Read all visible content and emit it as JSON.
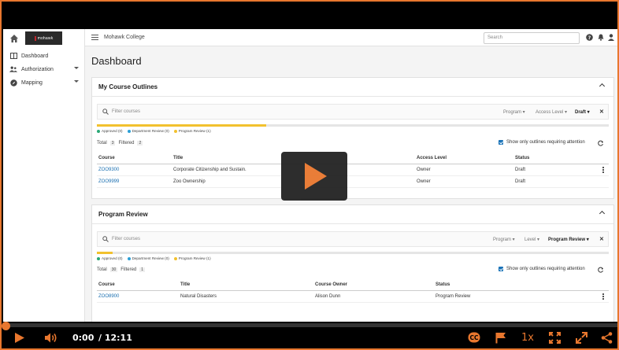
{
  "sidebar": {
    "logo_text": "mohawk",
    "items": [
      {
        "label": "Dashboard",
        "icon": "dashboard-icon"
      },
      {
        "label": "Authorization",
        "icon": "users-icon"
      },
      {
        "label": "Mapping",
        "icon": "compass-icon"
      }
    ]
  },
  "topbar": {
    "college": "Mohawk College",
    "search_placeholder": "Search"
  },
  "page": {
    "title": "Dashboard"
  },
  "outlines": {
    "title": "My Course Outlines",
    "filter_placeholder": "Filter courses",
    "filters": [
      "Program",
      "Access Level",
      "Draft"
    ],
    "progress": 0.33,
    "legend": [
      {
        "label": "Approved (0)",
        "color": "#2aa876"
      },
      {
        "label": "Department Review (0)",
        "color": "#2b9fd6"
      },
      {
        "label": "Program Review (1)",
        "color": "#f2c12e"
      }
    ],
    "total_label": "Total",
    "total": "3",
    "filtered_label": "Filtered",
    "filtered": "2",
    "attention": "Show only outlines requiring attention",
    "columns": [
      "Course",
      "Title",
      "Access Level",
      "Status"
    ],
    "rows": [
      {
        "course": "ZOO9300",
        "title": "Corporate Citizenship and Sustain.",
        "access": "Owner",
        "status": "Draft"
      },
      {
        "course": "ZOO9999",
        "title": "Zoo Ownership",
        "access": "Owner",
        "status": "Draft"
      }
    ]
  },
  "review": {
    "title": "Program Review",
    "filter_placeholder": "Filter courses",
    "filters": [
      "Program",
      "Level",
      "Program Review"
    ],
    "progress": 0.03,
    "legend": [
      {
        "label": "Approved (0)",
        "color": "#2aa876"
      },
      {
        "label": "Department Review (0)",
        "color": "#2b9fd6"
      },
      {
        "label": "Program Review (1)",
        "color": "#f2c12e"
      }
    ],
    "total_label": "Total",
    "total": "30",
    "filtered_label": "Filtered",
    "filtered": "1",
    "attention": "Show only outlines requiring attention",
    "columns": [
      "Course",
      "Title",
      "Course Owner",
      "Status"
    ],
    "rows": [
      {
        "course": "ZOO8900",
        "title": "Natural Disasters",
        "owner": "Alison Dunn",
        "status": "Program Review"
      }
    ]
  },
  "player": {
    "current_time": "0:00",
    "duration": "/ 12:11",
    "speed": "1x",
    "progress": 0,
    "accent": "#e8772e"
  }
}
